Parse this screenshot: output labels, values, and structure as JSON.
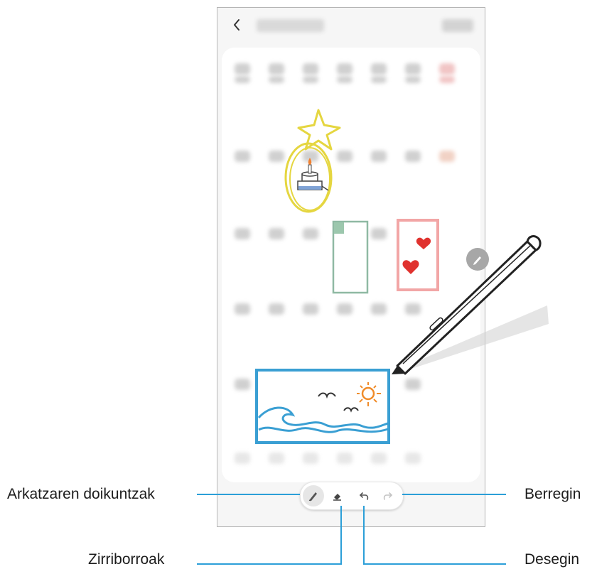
{
  "callouts": {
    "pen_settings": "Arkatzaren doikuntzak",
    "redo": "Berregin",
    "eraser": "Zirriborroak",
    "undo": "Desegin"
  },
  "toolbar": {
    "tools": [
      {
        "icon": "pen-icon",
        "state": "selected"
      },
      {
        "icon": "eraser-icon"
      },
      {
        "icon": "undo-icon"
      },
      {
        "icon": "redo-icon",
        "state": "disabled"
      }
    ]
  },
  "colors": {
    "callout_line": "#2c9fd8",
    "doodle_blue": "#3a9fd3",
    "doodle_yellow": "#e5d640",
    "doodle_green": "#8fb9a3",
    "doodle_pink": "#f2a6a6",
    "heart_red": "#e0322e"
  }
}
